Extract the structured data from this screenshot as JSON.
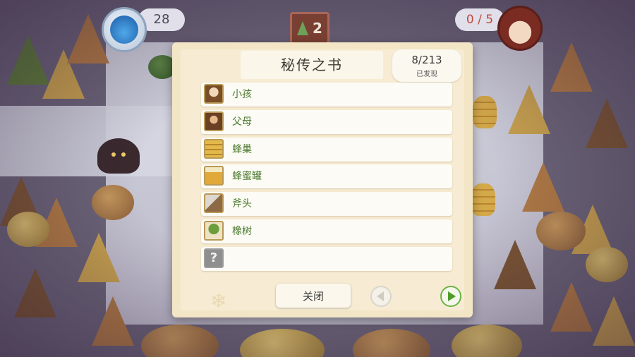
{
  "hud": {
    "counter_left": "28",
    "level": "2",
    "progress": "0 / 5"
  },
  "book": {
    "title": "秘传之书",
    "counter": "8/213",
    "counter_sub": "已发现",
    "entries": [
      {
        "label": "小孩",
        "icon": "child-icon"
      },
      {
        "label": "父母",
        "icon": "parents-icon"
      },
      {
        "label": "蜂巢",
        "icon": "beehive-icon"
      },
      {
        "label": "蜂蜜罐",
        "icon": "honey-jar-icon"
      },
      {
        "label": "斧头",
        "icon": "axe-icon"
      },
      {
        "label": "橡树",
        "icon": "oak-tree-icon"
      },
      {
        "label": "",
        "icon": "unknown-question-icon"
      }
    ],
    "close_label": "关闭"
  },
  "colors": {
    "entry_text": "#4b7a2e",
    "next_button": "#4f9c2a",
    "panel_bg": "#f3e6c6"
  }
}
